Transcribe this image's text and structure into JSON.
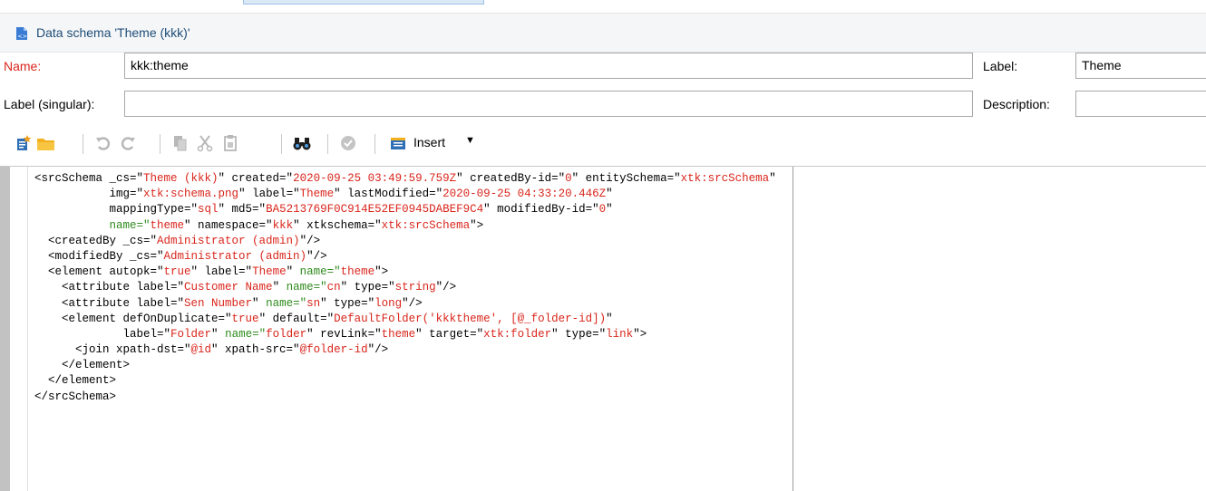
{
  "window": {
    "title": "Data schema 'Theme (kkk)'",
    "icon": "schema-file-icon"
  },
  "form": {
    "name_label": "Name:",
    "name_value": "kkk:theme",
    "label_label": "Label:",
    "label_value": "Theme",
    "singular_label": "Label (singular):",
    "singular_value": "",
    "description_label": "Description:",
    "description_value": ""
  },
  "toolbar": {
    "items": [
      "new-icon",
      "open-folder-icon",
      "undo-icon",
      "redo-icon",
      "copy-icon",
      "cut-icon",
      "paste-icon",
      "find-icon",
      "validate-icon",
      "insert-icon"
    ],
    "insert_label": "Insert"
  },
  "colors": {
    "attr_value": "#d9261c",
    "name_attr": "#2e8b1d",
    "title_text": "#1f4e79",
    "required_label": "#d9261c"
  },
  "code_lines": [
    [
      [
        "t",
        "<srcSchema _cs=\""
      ],
      [
        "v",
        "Theme (kkk)"
      ],
      [
        "t",
        "\" created=\""
      ],
      [
        "v",
        "2020-09-25 03:49:59.759Z"
      ],
      [
        "t",
        "\" createdBy-id=\""
      ],
      [
        "v",
        "0"
      ],
      [
        "t",
        "\" entitySchema=\""
      ],
      [
        "v",
        "xtk:srcSchema"
      ],
      [
        "t",
        "\""
      ]
    ],
    [
      [
        "t",
        "           img=\""
      ],
      [
        "v",
        "xtk:schema.png"
      ],
      [
        "t",
        "\" label=\""
      ],
      [
        "v",
        "Theme"
      ],
      [
        "t",
        "\" lastModified=\""
      ],
      [
        "v",
        "2020-09-25 04:33:20.446Z"
      ],
      [
        "t",
        "\""
      ]
    ],
    [
      [
        "t",
        "           mappingType=\""
      ],
      [
        "v",
        "sql"
      ],
      [
        "t",
        "\" md5=\""
      ],
      [
        "v",
        "BA5213769F0C914E52EF0945DABEF9C4"
      ],
      [
        "t",
        "\" modifiedBy-id=\""
      ],
      [
        "v",
        "0"
      ],
      [
        "t",
        "\""
      ]
    ],
    [
      [
        "t",
        "           "
      ],
      [
        "n",
        "name=\""
      ],
      [
        "v",
        "theme"
      ],
      [
        "t",
        "\" namespace=\""
      ],
      [
        "v",
        "kkk"
      ],
      [
        "t",
        "\" xtkschema=\""
      ],
      [
        "v",
        "xtk:srcSchema"
      ],
      [
        "t",
        "\">"
      ]
    ],
    [
      [
        "t",
        "  <createdBy _cs=\""
      ],
      [
        "v",
        "Administrator (admin)"
      ],
      [
        "t",
        "\"/>"
      ]
    ],
    [
      [
        "t",
        "  <modifiedBy _cs=\""
      ],
      [
        "v",
        "Administrator (admin)"
      ],
      [
        "t",
        "\"/>"
      ]
    ],
    [
      [
        "t",
        "  <element autopk=\""
      ],
      [
        "v",
        "true"
      ],
      [
        "t",
        "\" label=\""
      ],
      [
        "v",
        "Theme"
      ],
      [
        "t",
        "\" "
      ],
      [
        "n",
        "name=\""
      ],
      [
        "v",
        "theme"
      ],
      [
        "t",
        "\">"
      ]
    ],
    [
      [
        "t",
        "    <attribute label=\""
      ],
      [
        "v",
        "Customer Name"
      ],
      [
        "t",
        "\" "
      ],
      [
        "n",
        "name=\""
      ],
      [
        "v",
        "cn"
      ],
      [
        "t",
        "\" type=\""
      ],
      [
        "v",
        "string"
      ],
      [
        "t",
        "\"/>"
      ]
    ],
    [
      [
        "t",
        "    <attribute label=\""
      ],
      [
        "v",
        "Sen Number"
      ],
      [
        "t",
        "\" "
      ],
      [
        "n",
        "name=\""
      ],
      [
        "v",
        "sn"
      ],
      [
        "t",
        "\" type=\""
      ],
      [
        "v",
        "long"
      ],
      [
        "t",
        "\"/>"
      ]
    ],
    [
      [
        "t",
        "    <element defOnDuplicate=\""
      ],
      [
        "v",
        "true"
      ],
      [
        "t",
        "\" default=\""
      ],
      [
        "v",
        "DefaultFolder('kkktheme', [@_folder-id])"
      ],
      [
        "t",
        "\""
      ]
    ],
    [
      [
        "t",
        "             label=\""
      ],
      [
        "v",
        "Folder"
      ],
      [
        "t",
        "\" "
      ],
      [
        "n",
        "name=\""
      ],
      [
        "v",
        "folder"
      ],
      [
        "t",
        "\" revLink=\""
      ],
      [
        "v",
        "theme"
      ],
      [
        "t",
        "\" target=\""
      ],
      [
        "v",
        "xtk:folder"
      ],
      [
        "t",
        "\" type=\""
      ],
      [
        "v",
        "link"
      ],
      [
        "t",
        "\">"
      ]
    ],
    [
      [
        "t",
        "      <join xpath-dst=\""
      ],
      [
        "v",
        "@id"
      ],
      [
        "t",
        "\" xpath-src=\""
      ],
      [
        "v",
        "@folder-id"
      ],
      [
        "t",
        "\"/>"
      ]
    ],
    [
      [
        "t",
        "    </element>"
      ]
    ],
    [
      [
        "t",
        "  </element>"
      ]
    ],
    [
      [
        "t",
        "</srcSchema>"
      ]
    ]
  ]
}
